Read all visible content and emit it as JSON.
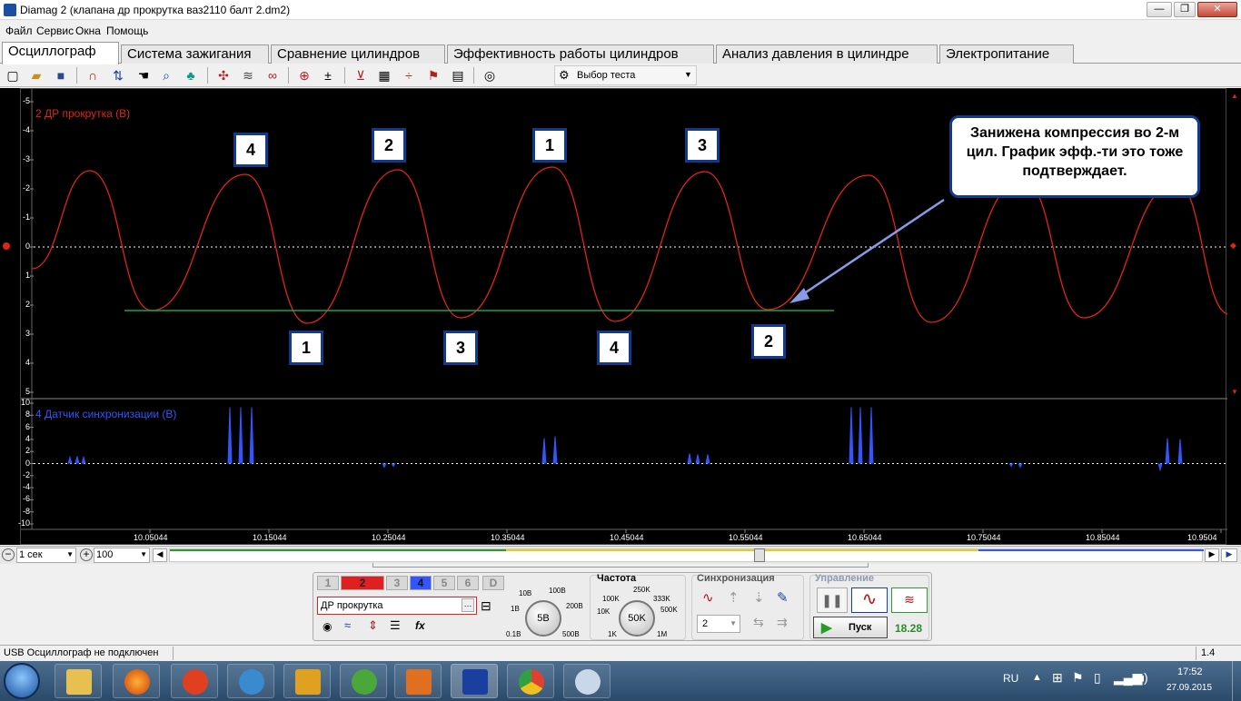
{
  "window": {
    "title": "Diamag 2 (клапана др прокрутка  ваз2110 балт 2.dm2)",
    "minimize": "—",
    "maximize": "❐",
    "close": "✕"
  },
  "menu": [
    "Файл",
    "Сервис",
    "Окна",
    "Помощь"
  ],
  "tabs": [
    "Осциллограф",
    "Система зажигания",
    "Сравнение цилиндров",
    "Эффективность работы цилиндров",
    "Анализ давления в цилиндре",
    "Электропитание"
  ],
  "toolbar": {
    "test_select_label": "Выбор теста",
    "icons": [
      "new-icon",
      "open-icon",
      "save-icon",
      "cursor-icon",
      "measure-icon",
      "hand-icon",
      "zoom-icon",
      "tree-icon",
      "sync-icon",
      "wave-icon",
      "spectrum-icon",
      "auto-icon",
      "zero-icon",
      "filter-icon",
      "table-icon",
      "split-icon",
      "flag-icon",
      "doc-icon",
      "auto-test-icon"
    ]
  },
  "scope": {
    "channel_top_label": "2 ДР прокрутка (В)",
    "channel_bottom_label": "4 Датчик синхронизации (В)",
    "y_top_labels": [
      "-5",
      "-4",
      "-3",
      "-2",
      "-1",
      "0",
      "1",
      "2",
      "3",
      "4",
      "5"
    ],
    "y_bottom_labels": [
      "10",
      "8",
      "6",
      "4",
      "2",
      "0",
      "-2",
      "-4",
      "-6",
      "-8",
      "-10"
    ],
    "x_labels": [
      "10.05044",
      "10.15044",
      "10.25044",
      "10.35044",
      "10.45044",
      "10.55044",
      "10.65044",
      "10.75044",
      "10.85044",
      "10.9504"
    ],
    "top_markers": [
      "4",
      "2",
      "1",
      "3"
    ],
    "bottom_markers": [
      "1",
      "3",
      "4",
      "2"
    ],
    "callout": "Занижена компрессия во 2-м цил. График эфф.-ти это тоже подтверждает.",
    "colors": {
      "trace_red": "#e2231a",
      "trace_blue": "#3355ff",
      "reference_green": "#19a34a",
      "callout_border": "#123a8c"
    }
  },
  "timeline": {
    "time_scale": "1 сек",
    "points": "100"
  },
  "panel": {
    "channels": [
      "1",
      "2",
      "3",
      "4",
      "5",
      "6",
      "D"
    ],
    "channel_name": "ДР прокрутка",
    "voltage_knob": "5В",
    "voltage_scale": [
      "10В",
      "100В",
      "1В",
      "200В",
      "0.1В",
      "500В"
    ],
    "frequency_title": "Частота",
    "frequency_knob": "50K",
    "frequency_scale": [
      "250K",
      "100K",
      "333K",
      "10K",
      "500K",
      "1K",
      "1M"
    ],
    "sync_title": "Синхронизация",
    "sync_channel": "2",
    "control_title": "Управление",
    "start_label": "Пуск",
    "time_value": "18.28"
  },
  "status": {
    "left": "USB Осциллограф не подключен",
    "right": "1.4"
  },
  "taskbar": {
    "lang": "RU",
    "time": "17:52",
    "date": "27.09.2015"
  }
}
